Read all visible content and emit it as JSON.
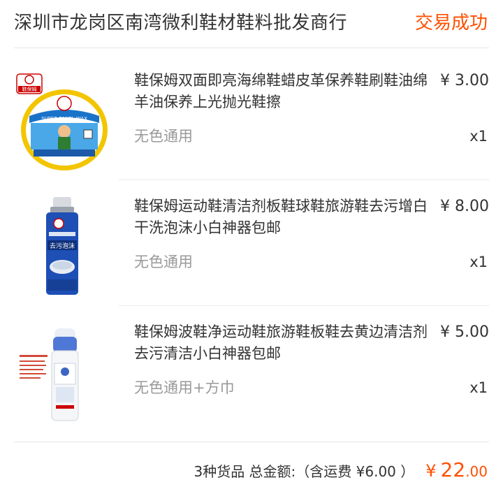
{
  "header": {
    "shop_name": "深圳市龙岗区南湾微利鞋材鞋料批发商行",
    "status": "交易成功"
  },
  "items": [
    {
      "title": "鞋保姆双面即亮海绵鞋蜡皮革保养鞋刷鞋油绵羊油保养上光抛光鞋擦",
      "price": "¥ 3.00",
      "sku": "无色通用",
      "qty": "x1",
      "image_labels": [
        "鞋保姆",
        "SUPER PANEL WAX"
      ]
    },
    {
      "title": "鞋保姆运动鞋清洁剂板鞋球鞋旅游鞋去污增白干洗泡沫小白神器包邮",
      "price": "¥ 8.00",
      "sku": "无色通用",
      "qty": "x1",
      "image_labels": [
        "去污泡沫"
      ]
    },
    {
      "title": "鞋保姆波鞋净运动鞋旅游鞋板鞋去黄边清洁剂去污清洁小白神器包邮",
      "price": "¥ 5.00",
      "sku": "无色通用+方巾",
      "qty": "x1",
      "image_labels": []
    }
  ],
  "summary": {
    "text": "3种货品 总金额:（含运费 ¥6.00 ）",
    "currency": "¥",
    "total_int": "22",
    "total_dec": ".00"
  },
  "colors": {
    "accent": "#ff5000",
    "muted": "#999999",
    "text": "#333333"
  }
}
